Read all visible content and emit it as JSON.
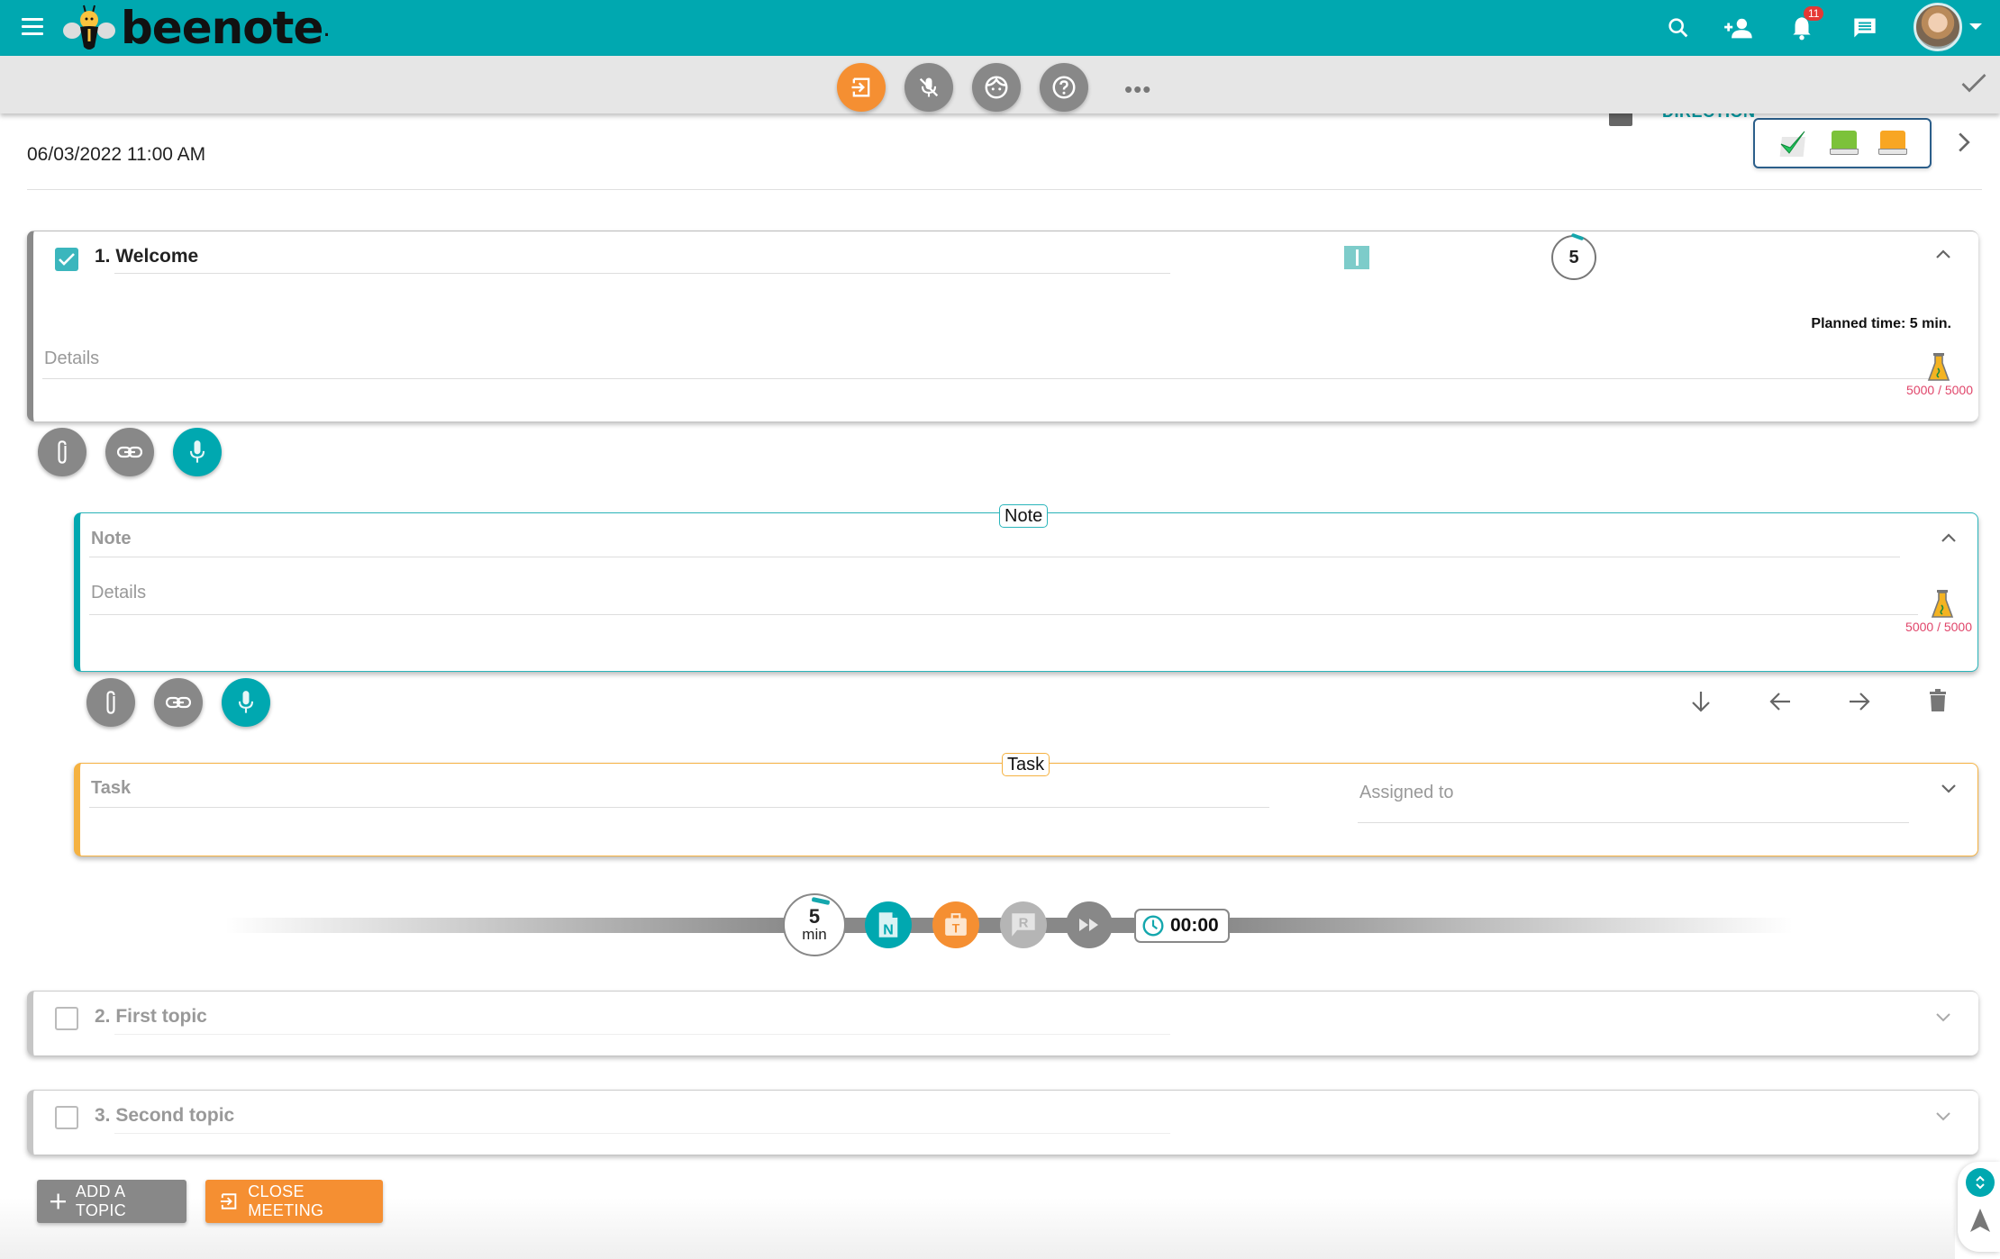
{
  "app": {
    "name": "beenote",
    "notification_count": "11"
  },
  "topbar": {
    "icons": [
      "menu-icon",
      "search-icon",
      "add-person-icon",
      "notifications-icon",
      "chat-icon",
      "avatar",
      "caret-down-icon"
    ]
  },
  "toolbar": {
    "buttons": [
      "exit-meeting",
      "mic-off",
      "face",
      "help",
      "more"
    ],
    "more_label": "•••"
  },
  "meeting": {
    "datetime": "06/03/2022 11:00 AM",
    "direction_label": "DIRECTION",
    "status_icons": [
      "check-icon",
      "green-book-icon",
      "orange-book-icon"
    ]
  },
  "topics": [
    {
      "number": "1.",
      "title": "Welcome",
      "checked": true,
      "expanded": true,
      "timer_minutes": "5",
      "planned_time": "Planned time: 5 min.",
      "details_placeholder": "Details",
      "char_count": "5000 / 5000"
    },
    {
      "number": "2.",
      "title": "First topic",
      "checked": false,
      "expanded": false
    },
    {
      "number": "3.",
      "title": "Second topic",
      "checked": false,
      "expanded": false
    }
  ],
  "note": {
    "tag": "Note",
    "title_placeholder": "Note",
    "details_placeholder": "Details",
    "char_count": "5000 / 5000"
  },
  "task": {
    "tag": "Task",
    "title_placeholder": "Task",
    "assigned_placeholder": "Assigned to"
  },
  "timeline": {
    "minutes": "5",
    "unit": "min",
    "note_letter": "N",
    "task_letter": "T",
    "r_letter": "R",
    "elapsed": "00:00"
  },
  "actions": {
    "add_topic": "ADD A TOPIC",
    "close_meeting": "CLOSE MEETING"
  },
  "colors": {
    "brand": "#00a8b0",
    "accent": "#f58f32",
    "task": "#f5b242",
    "neutral": "#888888",
    "counter": "#e0456a"
  }
}
